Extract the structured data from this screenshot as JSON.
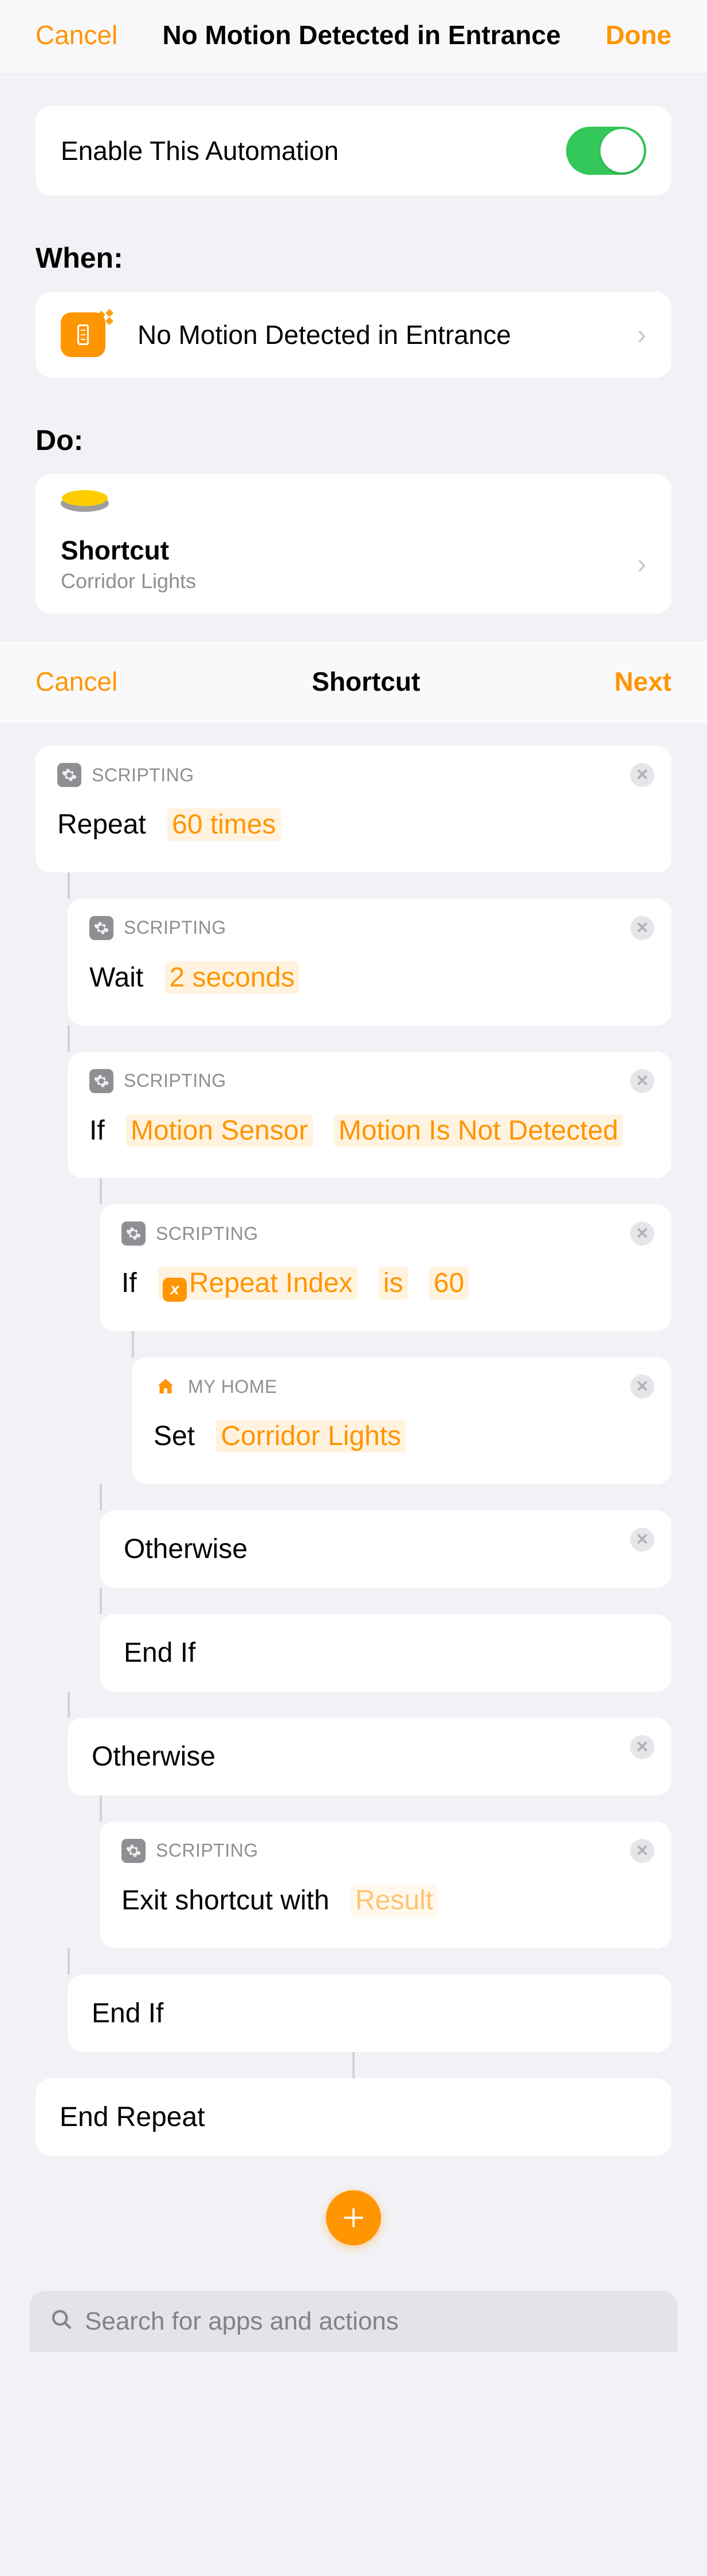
{
  "header1": {
    "cancel": "Cancel",
    "title": "No Motion Detected in Entrance",
    "done": "Done"
  },
  "enable": {
    "label": "Enable This Automation"
  },
  "sections": {
    "when": "When:",
    "do": "Do:"
  },
  "trigger": {
    "label": "No Motion Detected in Entrance"
  },
  "shortcut_card": {
    "title": "Shortcut",
    "subtitle": "Corridor Lights"
  },
  "header2": {
    "cancel": "Cancel",
    "title": "Shortcut",
    "next": "Next"
  },
  "labels": {
    "scripting": "SCRIPTING",
    "myhome": "MY HOME"
  },
  "steps": {
    "repeat": {
      "kw": "Repeat",
      "count": "60 times"
    },
    "wait": {
      "kw": "Wait",
      "dur": "2 seconds"
    },
    "if1": {
      "kw": "If",
      "a": "Motion Sensor",
      "b": "Motion Is Not Detected"
    },
    "if2": {
      "kw": "If",
      "var": "Repeat Index",
      "op": "is",
      "val": "60"
    },
    "set": {
      "kw": "Set",
      "scene": "Corridor Lights"
    },
    "otherwise": "Otherwise",
    "endif": "End If",
    "exit": {
      "kw": "Exit shortcut with",
      "res": "Result"
    },
    "endrepeat": "End Repeat"
  },
  "search": {
    "placeholder": "Search for apps and actions"
  }
}
